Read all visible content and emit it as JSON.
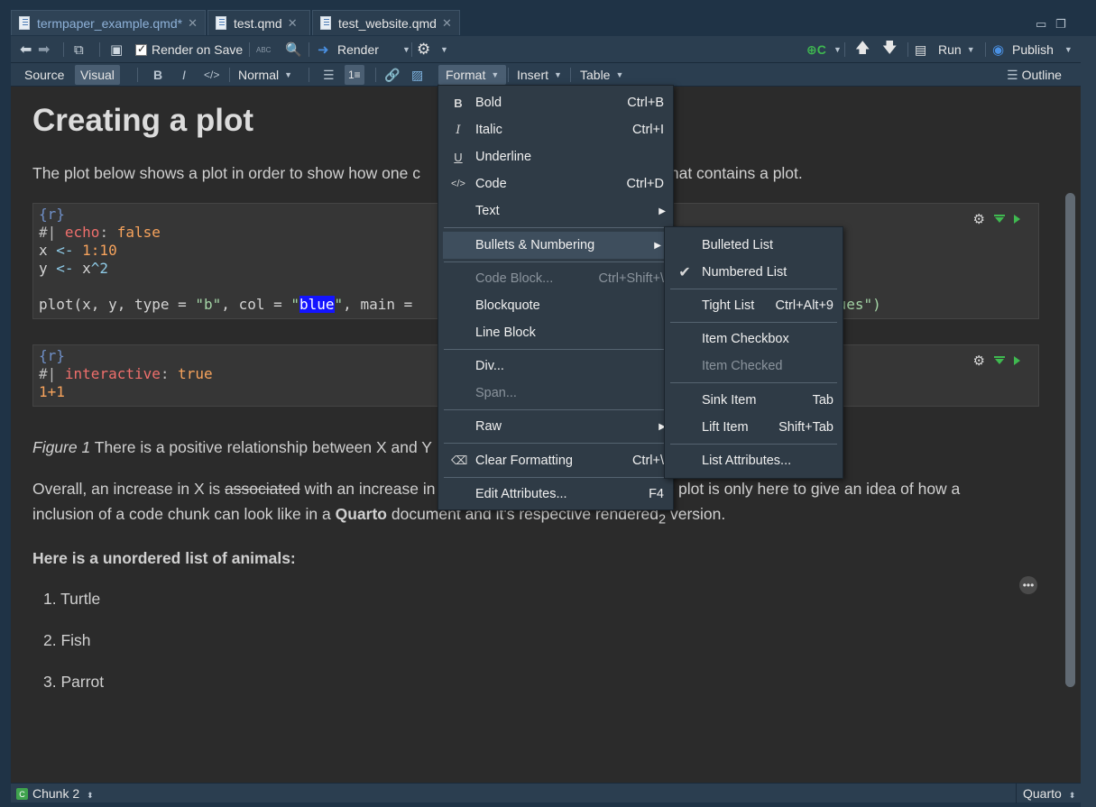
{
  "tabs": [
    {
      "label": "termpaper_example.qmd*",
      "active": true
    },
    {
      "label": "test.qmd",
      "active": false
    },
    {
      "label": "test_website.qmd",
      "active": false
    }
  ],
  "toolbar1": {
    "render_on_save": "Render on Save",
    "render": "Render",
    "run": "Run",
    "publish": "Publish"
  },
  "toolbar2": {
    "source": "Source",
    "visual": "Visual",
    "bold": "B",
    "italic": "I",
    "code": "</>",
    "style": "Normal",
    "format": "Format",
    "insert": "Insert",
    "table": "Table",
    "outline": "Outline"
  },
  "doc": {
    "title": "Creating a plot",
    "intro": "The plot below shows a plot in order to show how one c",
    "intro_tail": "that contains a plot.",
    "chunk1": {
      "header": "{r}",
      "line2_hash": "#| ",
      "line2_key": "echo",
      "line2_colon": ": ",
      "line2_val": "false",
      "line3_a": "x ",
      "line3_op": "<-",
      "line3_num": " 1:10",
      "line4_a": "y ",
      "line4_op": "<-",
      "line4_b": " x",
      "line4_c": "^2",
      "line6_a": "plot(x, y, type = ",
      "line6_str1": "\"b\"",
      "line6_b": ", col = ",
      "line6_q1": "\"",
      "line6_hl": "blue",
      "line6_q2": "\"",
      "line6_c": ", main = ",
      "line6_tail": "lues\")"
    },
    "chunk2": {
      "header": "{r}",
      "line2_hash": "#| ",
      "line2_key": "interactive",
      "line2_colon": ": ",
      "line2_val": "true",
      "line3": "1+1"
    },
    "caption_label": "Figure 1",
    "caption_text": " There is a positive relationship between X and Y",
    "para2_a": "Overall, an increase in X is ",
    "para2_strike": "associated",
    "para2_b": " with an increase in",
    "para2_tail": " plot is only here to give an idea of how a",
    "para3_a": "inclusion of a code chunk can look like in a ",
    "para3_bold": "Quarto",
    "para3_b": " document and it's respective rendered",
    "para3_sub": "2",
    "para3_c": " version.",
    "list_heading": "Here is a unordered list of animals:",
    "list": [
      "1. Turtle",
      "2. Fish",
      "3. Parrot"
    ]
  },
  "format_menu": {
    "items": [
      {
        "icon": "B",
        "label": "Bold",
        "shortcut": "Ctrl+B"
      },
      {
        "icon": "I",
        "label": "Italic",
        "shortcut": "Ctrl+I"
      },
      {
        "icon": "U",
        "label": "Underline",
        "shortcut": ""
      },
      {
        "icon": "</>",
        "label": "Code",
        "shortcut": "Ctrl+D"
      },
      {
        "icon": "",
        "label": "Text",
        "shortcut": ""
      },
      {
        "icon": "",
        "label": "Bullets & Numbering",
        "shortcut": ""
      },
      {
        "icon": "",
        "label": "Code Block...",
        "shortcut": "Ctrl+Shift+\\"
      },
      {
        "icon": "",
        "label": "Blockquote",
        "shortcut": ""
      },
      {
        "icon": "",
        "label": "Line Block",
        "shortcut": ""
      },
      {
        "icon": "",
        "label": "Div...",
        "shortcut": ""
      },
      {
        "icon": "",
        "label": "Span...",
        "shortcut": ""
      },
      {
        "icon": "",
        "label": "Raw",
        "shortcut": ""
      },
      {
        "icon": "",
        "label": "Clear Formatting",
        "shortcut": "Ctrl+\\"
      },
      {
        "icon": "",
        "label": "Edit Attributes...",
        "shortcut": "F4"
      }
    ]
  },
  "bullets_menu": {
    "items": [
      {
        "label": "Bulleted List",
        "shortcut": ""
      },
      {
        "label": "Numbered List",
        "shortcut": ""
      },
      {
        "label": "Tight List",
        "shortcut": "Ctrl+Alt+9"
      },
      {
        "label": "Item Checkbox",
        "shortcut": ""
      },
      {
        "label": "Item Checked",
        "shortcut": ""
      },
      {
        "label": "Sink Item",
        "shortcut": "Tab"
      },
      {
        "label": "Lift Item",
        "shortcut": "Shift+Tab"
      },
      {
        "label": "List Attributes...",
        "shortcut": ""
      }
    ]
  },
  "status": {
    "chunk": "Chunk 2",
    "mode": "Quarto"
  }
}
